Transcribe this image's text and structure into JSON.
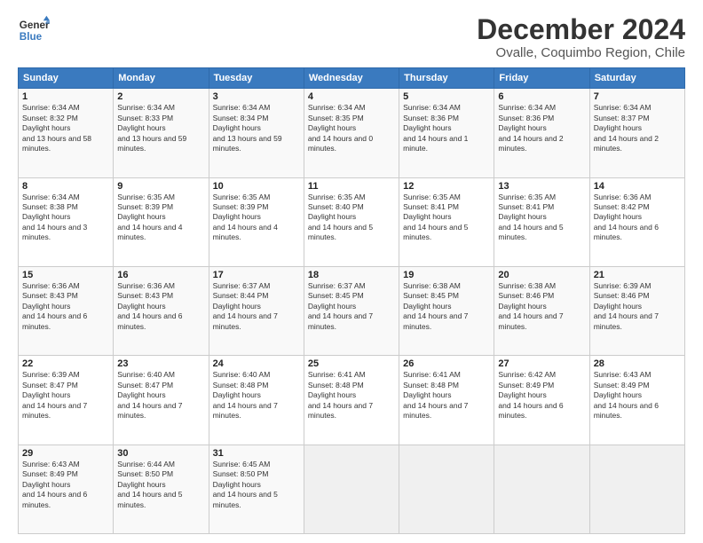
{
  "header": {
    "logo_line1": "General",
    "logo_line2": "Blue",
    "title": "December 2024",
    "subtitle": "Ovalle, Coquimbo Region, Chile"
  },
  "weekdays": [
    "Sunday",
    "Monday",
    "Tuesday",
    "Wednesday",
    "Thursday",
    "Friday",
    "Saturday"
  ],
  "weeks": [
    [
      {
        "day": "1",
        "rise": "6:34 AM",
        "set": "8:32 PM",
        "hours": "13 hours and 58 minutes."
      },
      {
        "day": "2",
        "rise": "6:34 AM",
        "set": "8:33 PM",
        "hours": "13 hours and 59 minutes."
      },
      {
        "day": "3",
        "rise": "6:34 AM",
        "set": "8:34 PM",
        "hours": "13 hours and 59 minutes."
      },
      {
        "day": "4",
        "rise": "6:34 AM",
        "set": "8:35 PM",
        "hours": "14 hours and 0 minutes."
      },
      {
        "day": "5",
        "rise": "6:34 AM",
        "set": "8:36 PM",
        "hours": "14 hours and 1 minute."
      },
      {
        "day": "6",
        "rise": "6:34 AM",
        "set": "8:36 PM",
        "hours": "14 hours and 2 minutes."
      },
      {
        "day": "7",
        "rise": "6:34 AM",
        "set": "8:37 PM",
        "hours": "14 hours and 2 minutes."
      }
    ],
    [
      {
        "day": "8",
        "rise": "6:34 AM",
        "set": "8:38 PM",
        "hours": "14 hours and 3 minutes."
      },
      {
        "day": "9",
        "rise": "6:35 AM",
        "set": "8:39 PM",
        "hours": "14 hours and 4 minutes."
      },
      {
        "day": "10",
        "rise": "6:35 AM",
        "set": "8:39 PM",
        "hours": "14 hours and 4 minutes."
      },
      {
        "day": "11",
        "rise": "6:35 AM",
        "set": "8:40 PM",
        "hours": "14 hours and 5 minutes."
      },
      {
        "day": "12",
        "rise": "6:35 AM",
        "set": "8:41 PM",
        "hours": "14 hours and 5 minutes."
      },
      {
        "day": "13",
        "rise": "6:35 AM",
        "set": "8:41 PM",
        "hours": "14 hours and 5 minutes."
      },
      {
        "day": "14",
        "rise": "6:36 AM",
        "set": "8:42 PM",
        "hours": "14 hours and 6 minutes."
      }
    ],
    [
      {
        "day": "15",
        "rise": "6:36 AM",
        "set": "8:43 PM",
        "hours": "14 hours and 6 minutes."
      },
      {
        "day": "16",
        "rise": "6:36 AM",
        "set": "8:43 PM",
        "hours": "14 hours and 6 minutes."
      },
      {
        "day": "17",
        "rise": "6:37 AM",
        "set": "8:44 PM",
        "hours": "14 hours and 7 minutes."
      },
      {
        "day": "18",
        "rise": "6:37 AM",
        "set": "8:45 PM",
        "hours": "14 hours and 7 minutes."
      },
      {
        "day": "19",
        "rise": "6:38 AM",
        "set": "8:45 PM",
        "hours": "14 hours and 7 minutes."
      },
      {
        "day": "20",
        "rise": "6:38 AM",
        "set": "8:46 PM",
        "hours": "14 hours and 7 minutes."
      },
      {
        "day": "21",
        "rise": "6:39 AM",
        "set": "8:46 PM",
        "hours": "14 hours and 7 minutes."
      }
    ],
    [
      {
        "day": "22",
        "rise": "6:39 AM",
        "set": "8:47 PM",
        "hours": "14 hours and 7 minutes."
      },
      {
        "day": "23",
        "rise": "6:40 AM",
        "set": "8:47 PM",
        "hours": "14 hours and 7 minutes."
      },
      {
        "day": "24",
        "rise": "6:40 AM",
        "set": "8:48 PM",
        "hours": "14 hours and 7 minutes."
      },
      {
        "day": "25",
        "rise": "6:41 AM",
        "set": "8:48 PM",
        "hours": "14 hours and 7 minutes."
      },
      {
        "day": "26",
        "rise": "6:41 AM",
        "set": "8:48 PM",
        "hours": "14 hours and 7 minutes."
      },
      {
        "day": "27",
        "rise": "6:42 AM",
        "set": "8:49 PM",
        "hours": "14 hours and 6 minutes."
      },
      {
        "day": "28",
        "rise": "6:43 AM",
        "set": "8:49 PM",
        "hours": "14 hours and 6 minutes."
      }
    ],
    [
      {
        "day": "29",
        "rise": "6:43 AM",
        "set": "8:49 PM",
        "hours": "14 hours and 6 minutes."
      },
      {
        "day": "30",
        "rise": "6:44 AM",
        "set": "8:50 PM",
        "hours": "14 hours and 5 minutes."
      },
      {
        "day": "31",
        "rise": "6:45 AM",
        "set": "8:50 PM",
        "hours": "14 hours and 5 minutes."
      },
      null,
      null,
      null,
      null
    ]
  ]
}
